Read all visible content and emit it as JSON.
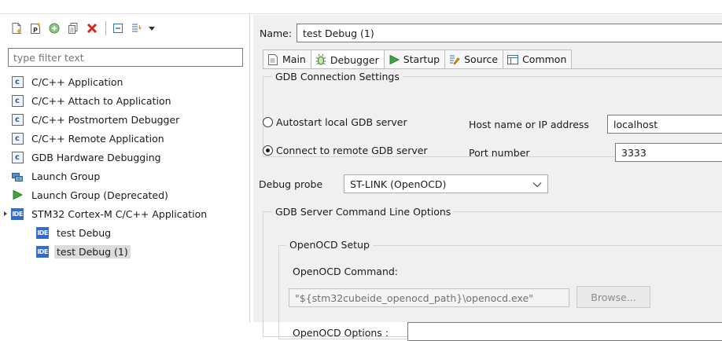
{
  "toolbar": {
    "icons": [
      "new-configuration-icon",
      "new-prototype-icon",
      "export-icon",
      "duplicate-icon",
      "delete-icon",
      "collapse-all-icon",
      "filter-icon",
      "dropdown-icon"
    ]
  },
  "filter": {
    "placeholder": "type filter text"
  },
  "tree": {
    "items": [
      {
        "label": "C/C++ Application",
        "icon": "c-app-icon"
      },
      {
        "label": "C/C++ Attach to Application",
        "icon": "c-app-icon"
      },
      {
        "label": "C/C++ Postmortem Debugger",
        "icon": "c-app-icon"
      },
      {
        "label": "C/C++ Remote Application",
        "icon": "c-app-icon"
      },
      {
        "label": "GDB Hardware Debugging",
        "icon": "c-app-icon"
      },
      {
        "label": "Launch Group",
        "icon": "launch-group-icon"
      },
      {
        "label": "Launch Group (Deprecated)",
        "icon": "play-icon"
      },
      {
        "label": "STM32 Cortex-M C/C++ Application",
        "icon": "ide-icon",
        "expanded": true
      },
      {
        "label": "test Debug",
        "icon": "ide-icon"
      },
      {
        "label": "test Debug (1)",
        "icon": "ide-icon",
        "selected": true
      }
    ]
  },
  "config": {
    "name_label": "Name:",
    "name_value": "test Debug (1)"
  },
  "tabs": [
    {
      "label": "Main",
      "icon": "main-tab-icon"
    },
    {
      "label": "Debugger",
      "icon": "debugger-tab-icon",
      "active": true
    },
    {
      "label": "Startup",
      "icon": "startup-tab-icon"
    },
    {
      "label": "Source",
      "icon": "source-tab-icon"
    },
    {
      "label": "Common",
      "icon": "common-tab-icon"
    }
  ],
  "gdb": {
    "group_title": "GDB Connection Settings",
    "autostart_label": "Autostart local GDB server",
    "remote_label": "Connect to remote GDB server",
    "selected_option": "Connect to remote GDB server",
    "host_label": "Host name or IP address",
    "host_value": "localhost",
    "port_label": "Port number",
    "port_value": "3333"
  },
  "probe": {
    "label": "Debug probe",
    "value": "ST-LINK (OpenOCD)"
  },
  "server_options": {
    "group_title": "GDB Server Command Line Options",
    "setup_title": "OpenOCD Setup",
    "command_label": "OpenOCD Command:",
    "command_value": "\"${stm32cubeide_openocd_path}\\openocd.exe\"",
    "browse_label": "Browse...",
    "options_label": "OpenOCD Options :"
  },
  "colors": {
    "selection": "#dcdcdc",
    "panel": "#f0f0f0",
    "ide_icon": "#2d6bd5"
  }
}
